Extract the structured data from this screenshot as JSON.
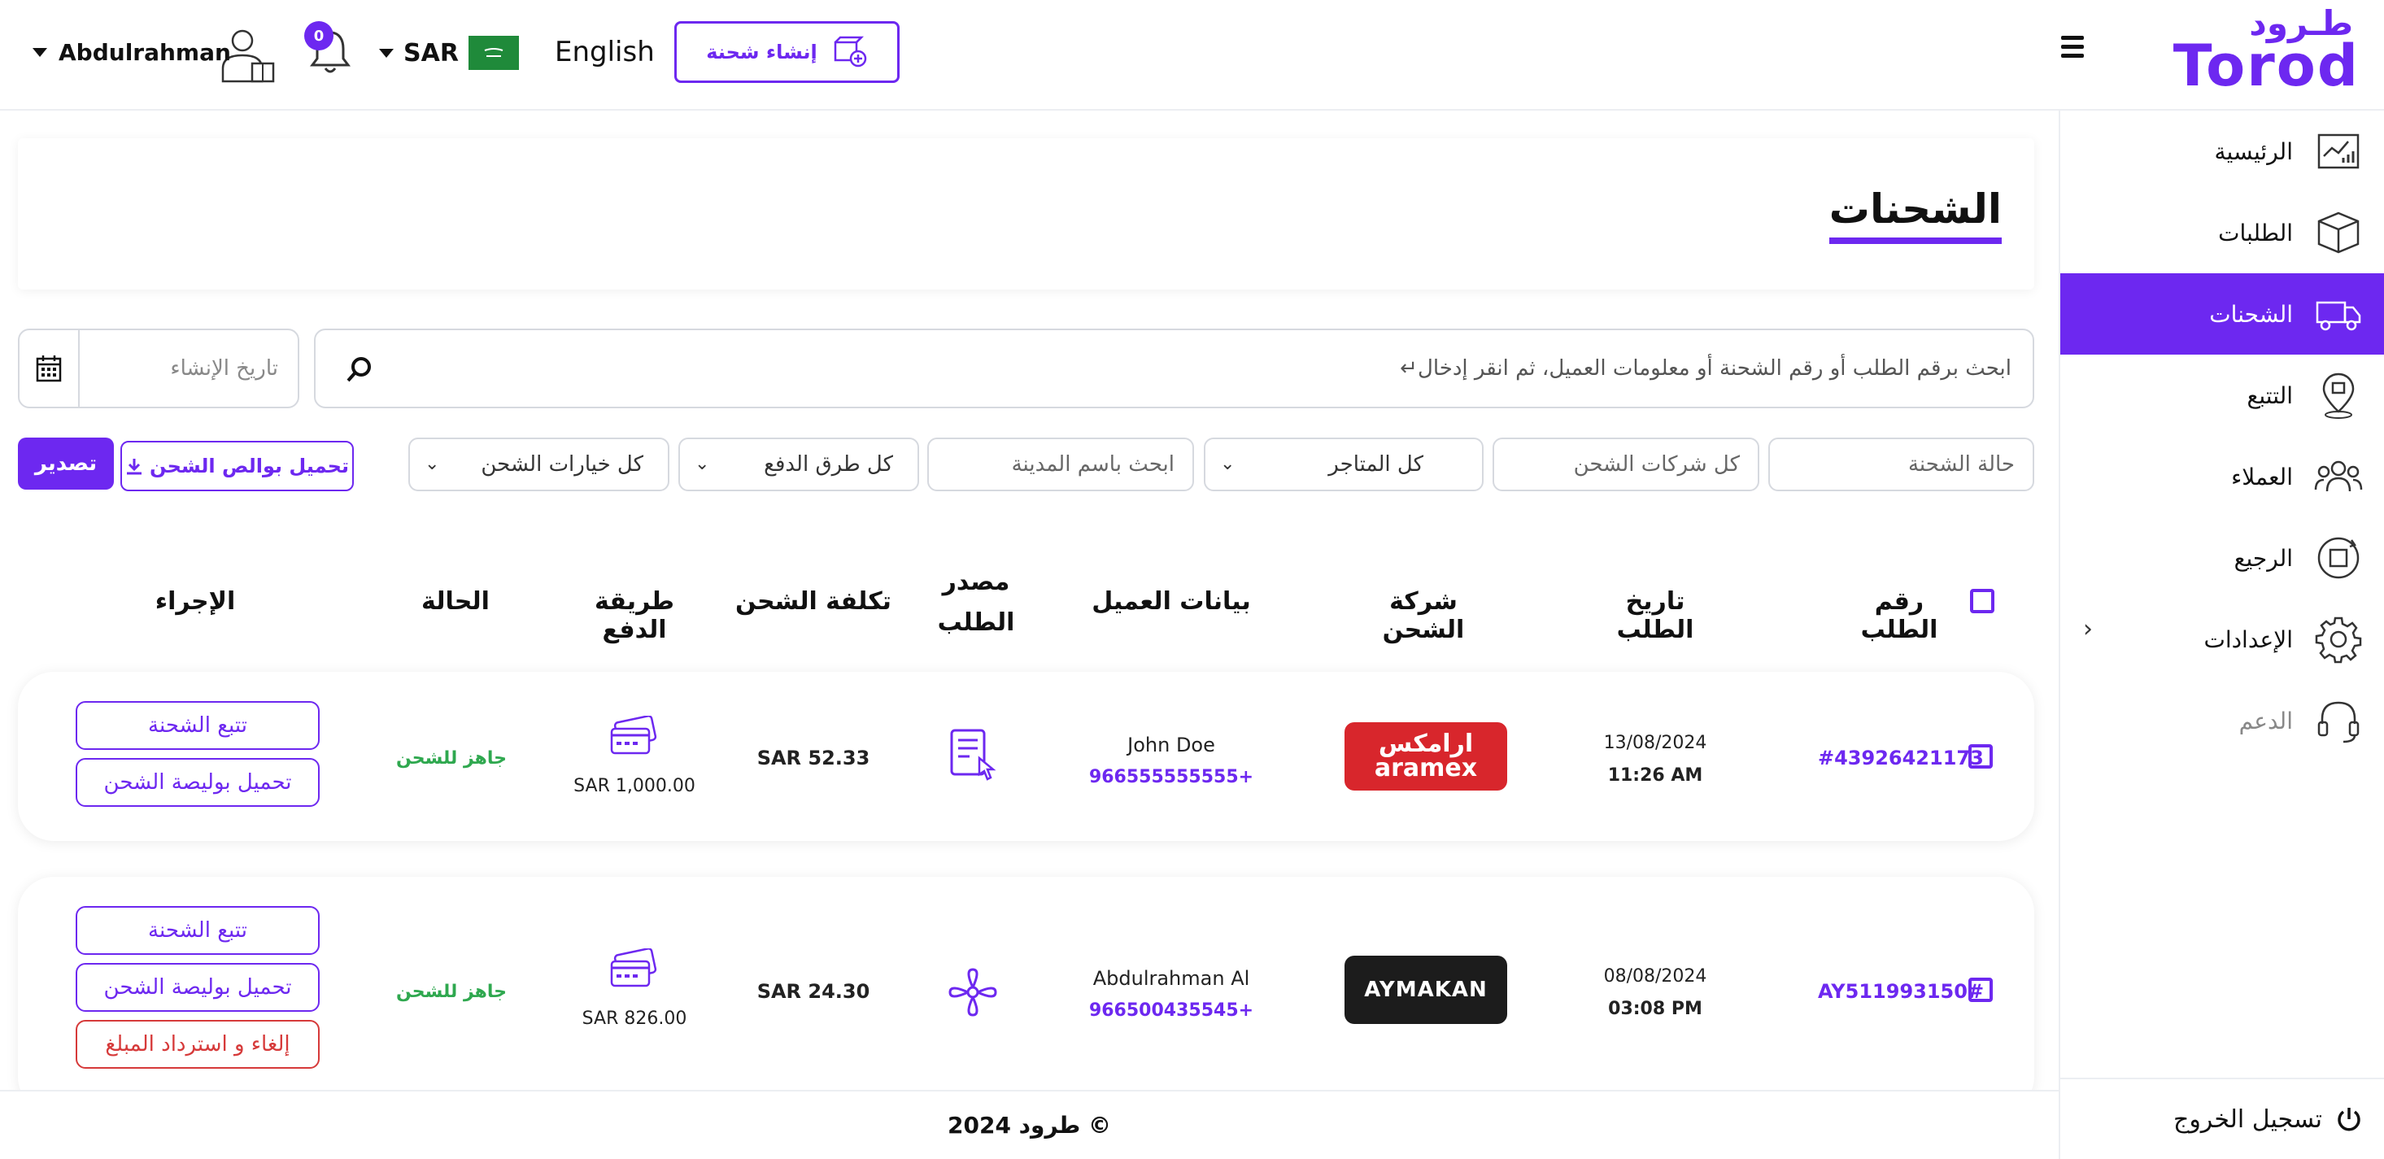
{
  "header": {
    "logo_ar": "طـرود",
    "logo_en": "Torod",
    "create_button": "إنشاء شحنة",
    "language": "English",
    "currency": "SAR",
    "notifications_count": "0",
    "user_name": "Abdulrahman",
    "brand_color": "#6d28f0"
  },
  "sidebar": {
    "items": [
      {
        "label": "الرئيسية",
        "icon": "dashboard-chart-icon"
      },
      {
        "label": "الطلبات",
        "icon": "box-icon"
      },
      {
        "label": "الشحنات",
        "icon": "truck-icon",
        "active": true
      },
      {
        "label": "التتبع",
        "icon": "location-pin-icon"
      },
      {
        "label": "العملاء",
        "icon": "users-icon"
      },
      {
        "label": "الرجيع",
        "icon": "return-box-icon"
      },
      {
        "label": "الإعدادات",
        "icon": "gear-icon"
      },
      {
        "label": "الدعم",
        "icon": "headset-icon"
      }
    ],
    "logout": "تسجيل الخروج"
  },
  "page": {
    "title": "الشحنات"
  },
  "search": {
    "placeholder": "ابحث برقم الطلب أو رقم الشحنة أو معلومات العميل، ثم انقر إدخال↵",
    "date_placeholder": "تاريخ الإنشاء"
  },
  "filters": {
    "shipment_status": "حالة الشحنة",
    "all_carriers": "كل شركات الشحن",
    "all_stores": "كل المتاجر",
    "city_search": "ابحث باسم المدينة",
    "all_payment_methods": "كل طرق الدفع",
    "all_shipping_options": "كل خيارات الشحن",
    "download_waybills": "تحميل بوالص الشحن",
    "export": "تصدير"
  },
  "table": {
    "headers": {
      "order_no": "رقم الطلب",
      "order_date": "تاريخ الطلب",
      "carrier": "شركة الشحن",
      "customer": "بيانات العميل",
      "source_line1": "مصدر",
      "source_line2": "الطلب",
      "shipping_cost": "تكلفة الشحن",
      "payment_method": "طريقة الدفع",
      "status": "الحالة",
      "action": "الإجراء"
    },
    "rows": [
      {
        "order_no": "#43926421173",
        "date": "13/08/2024",
        "time": "11:26 AM",
        "carrier_ar": "ارامكس",
        "carrier_en": "aramex",
        "customer_name": "John Doe",
        "customer_phone": "966555555555+",
        "source_icon": "document-click-icon",
        "shipping_cost": "SAR 52.33",
        "payment_amount": "SAR 1,000.00",
        "payment_icon": "credit-card-icon",
        "status": "جاهز للشحن",
        "actions": [
          "تتبع الشحنة",
          "تحميل بوليصة الشحن"
        ]
      },
      {
        "order_no": "AY511993150#",
        "date": "08/08/2024",
        "time": "03:08 PM",
        "carrier_en": "AYMAKAN",
        "customer_name": "Abdulrahman Al",
        "customer_phone": "966500435545+",
        "source_icon": "integration-icon",
        "shipping_cost": "SAR 24.30",
        "payment_amount": "SAR 826.00",
        "payment_icon": "credit-card-icon",
        "status": "جاهز للشحن",
        "actions": [
          "تتبع الشحنة",
          "تحميل بوليصة الشحن",
          "إلغاء و استرداد المبلغ"
        ]
      }
    ]
  },
  "footer": {
    "copyright": "طرود 2024 ©"
  }
}
